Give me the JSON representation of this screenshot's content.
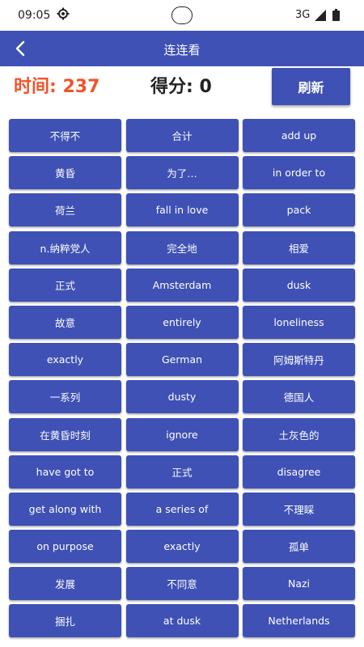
{
  "status": {
    "time": "09:05",
    "network": "3G"
  },
  "header": {
    "title": "连连看"
  },
  "game": {
    "timer": "时间: 237",
    "score": "得分: 0",
    "refresh_label": "刷新"
  },
  "tiles": [
    "不得不",
    "合计",
    "add up",
    "黄昏",
    "为了…",
    "in order to",
    "荷兰",
    "fall in love",
    "pack",
    "n.纳粹党人",
    "完全地",
    "相爱",
    "正式",
    "Amsterdam",
    "dusk",
    "故意",
    "entirely",
    "loneliness",
    "exactly",
    "German",
    "阿姆斯特丹",
    "一系列",
    "dusty",
    "德国人",
    "在黄昏时刻",
    "ignore",
    "土灰色的",
    "have got to",
    "正式",
    "disagree",
    "get along with",
    "a series of",
    "不理睬",
    "on purpose",
    "exactly",
    "孤单",
    "发展",
    "不同意",
    "Nazi",
    "捆扎",
    "at dusk",
    "Netherlands"
  ],
  "colors": {
    "primary": "#3f51b5",
    "timer": "#f0542a"
  }
}
